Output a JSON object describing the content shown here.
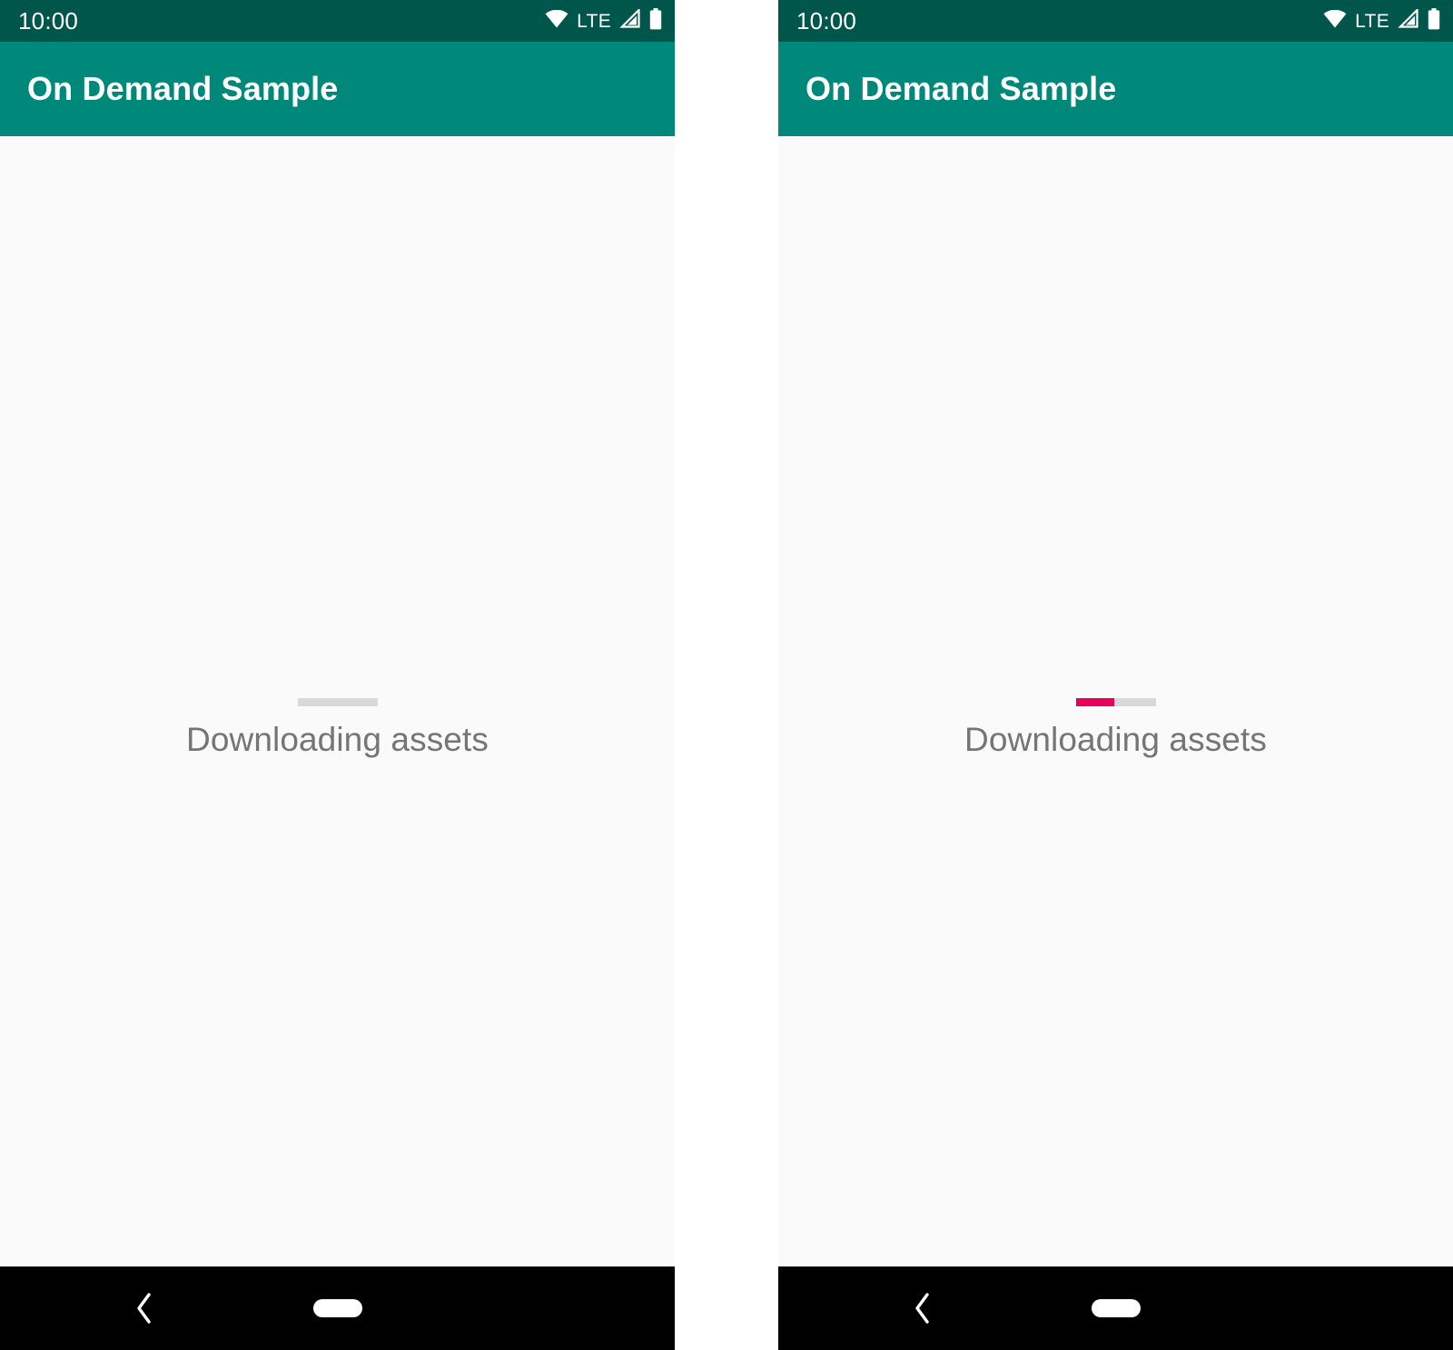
{
  "meta": {
    "description": "Two side-by-side Android phone screenshots of an on-demand asset download screen"
  },
  "colors": {
    "status_bar_bg": "#00564B",
    "app_bar_bg": "#00897B",
    "content_bg": "#FAFAFA",
    "nav_bar_bg": "#000000",
    "progress_track": "#D8D8D8",
    "progress_fill": "#E8005A",
    "label_text": "#757575",
    "title_text": "#FFFFFF",
    "gutter_bg": "#FFFFFF"
  },
  "panels": [
    {
      "id": "panel-left",
      "status_bar": {
        "clock": "10:00",
        "icons": [
          {
            "name": "wifi-icon",
            "label": "Wi-Fi"
          },
          {
            "name": "lte-label",
            "label": "LTE"
          },
          {
            "name": "cellular-signal-icon",
            "label": "Cellular signal"
          },
          {
            "name": "battery-icon",
            "label": "Battery"
          }
        ]
      },
      "app_bar": {
        "title": "On Demand Sample"
      },
      "content": {
        "progress": {
          "value": 0,
          "max": 100,
          "display": "0%"
        },
        "label": "Downloading assets"
      },
      "nav_bar": {
        "back": "back-button",
        "home": "home-pill-button"
      }
    },
    {
      "id": "panel-right",
      "status_bar": {
        "clock": "10:00",
        "icons": [
          {
            "name": "wifi-icon",
            "label": "Wi-Fi"
          },
          {
            "name": "lte-label",
            "label": "LTE"
          },
          {
            "name": "cellular-signal-icon",
            "label": "Cellular signal"
          },
          {
            "name": "battery-icon",
            "label": "Battery"
          }
        ]
      },
      "app_bar": {
        "title": "On Demand Sample"
      },
      "content": {
        "progress": {
          "value": 48,
          "max": 100,
          "display": "48%"
        },
        "label": "Downloading assets"
      },
      "nav_bar": {
        "back": "back-button",
        "home": "home-pill-button"
      }
    }
  ]
}
